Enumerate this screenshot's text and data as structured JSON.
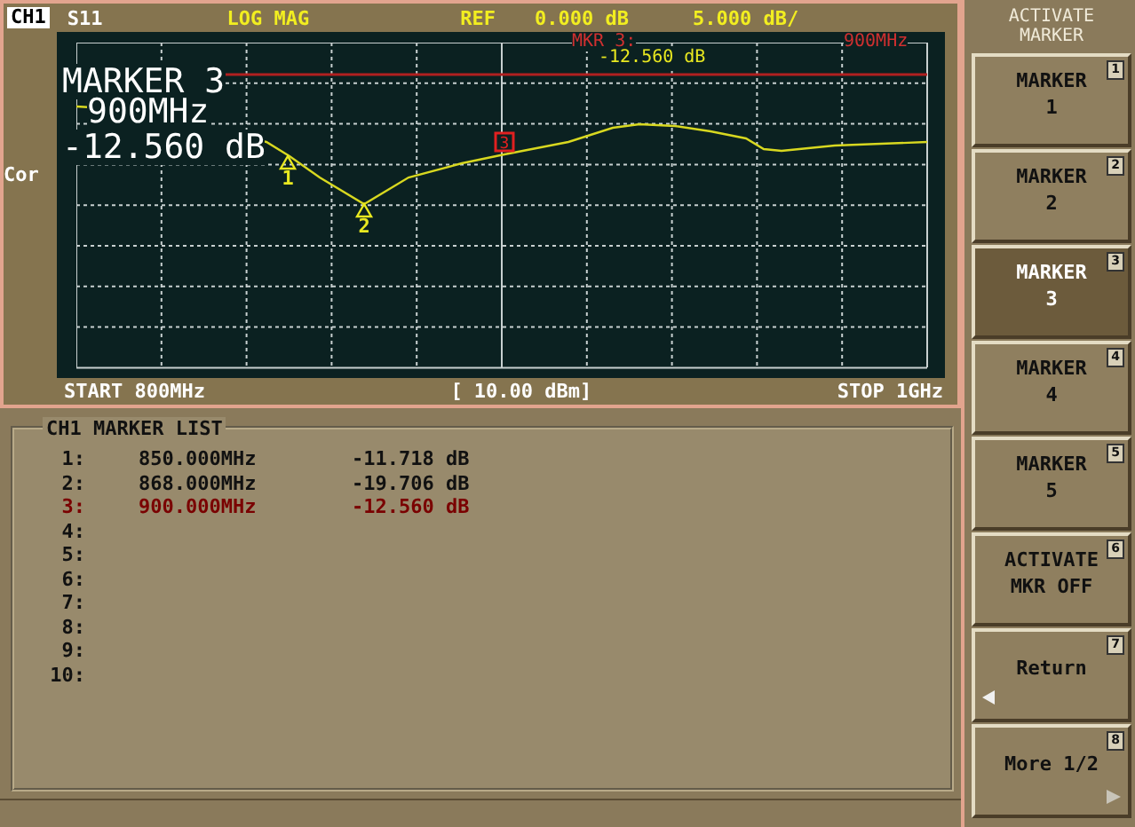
{
  "header": {
    "channel": "CH1",
    "parameter": "S11",
    "format": "LOG MAG",
    "ref_label": "REF",
    "ref_value": "0.000 dB",
    "scale": "5.000 dB/"
  },
  "side_label": "Cor",
  "plot": {
    "active_marker": {
      "title": "MARKER 3",
      "frequency": "900MHz",
      "value": "-12.560 dB"
    },
    "readout": {
      "label": "MKR 3:",
      "value": "-12.560 dB",
      "frequency": "900MHz"
    },
    "markers": [
      {
        "label": "1",
        "selected": false
      },
      {
        "label": "2",
        "selected": false
      },
      {
        "label": "3",
        "selected": true
      }
    ]
  },
  "footer": {
    "start": "START 800MHz",
    "power": "[ 10.00 dBm]",
    "stop": "STOP 1GHz"
  },
  "marker_list": {
    "title": "CH1 MARKER LIST",
    "rows": [
      {
        "index": "1:",
        "frequency": "850.000MHz",
        "value": "-11.718 dB",
        "selected": false
      },
      {
        "index": "2:",
        "frequency": "868.000MHz",
        "value": "-19.706 dB",
        "selected": false
      },
      {
        "index": "3:",
        "frequency": "900.000MHz",
        "value": "-12.560 dB",
        "selected": true
      },
      {
        "index": "4:"
      },
      {
        "index": "5:"
      },
      {
        "index": "6:"
      },
      {
        "index": "7:"
      },
      {
        "index": "8:"
      },
      {
        "index": "9:"
      },
      {
        "index": "10:"
      }
    ]
  },
  "softkeys": {
    "title_lines": [
      "ACTIVATE",
      "MARKER"
    ],
    "keys": [
      {
        "lines": [
          "MARKER",
          "1"
        ],
        "number": "1",
        "selected": false,
        "kind": "plain"
      },
      {
        "lines": [
          "MARKER",
          "2"
        ],
        "number": "2",
        "selected": false,
        "kind": "plain"
      },
      {
        "lines": [
          "MARKER",
          "3"
        ],
        "number": "3",
        "selected": true,
        "kind": "plain"
      },
      {
        "lines": [
          "MARKER",
          "4"
        ],
        "number": "4",
        "selected": false,
        "kind": "plain"
      },
      {
        "lines": [
          "MARKER",
          "5"
        ],
        "number": "5",
        "selected": false,
        "kind": "plain"
      },
      {
        "lines": [
          "ACTIVATE",
          "MKR OFF"
        ],
        "number": "6",
        "selected": false,
        "kind": "plain"
      },
      {
        "lines": [
          "Return"
        ],
        "number": "7",
        "selected": false,
        "kind": "back"
      },
      {
        "lines": [
          "More 1/2"
        ],
        "number": "8",
        "selected": false,
        "kind": "next"
      }
    ]
  }
}
